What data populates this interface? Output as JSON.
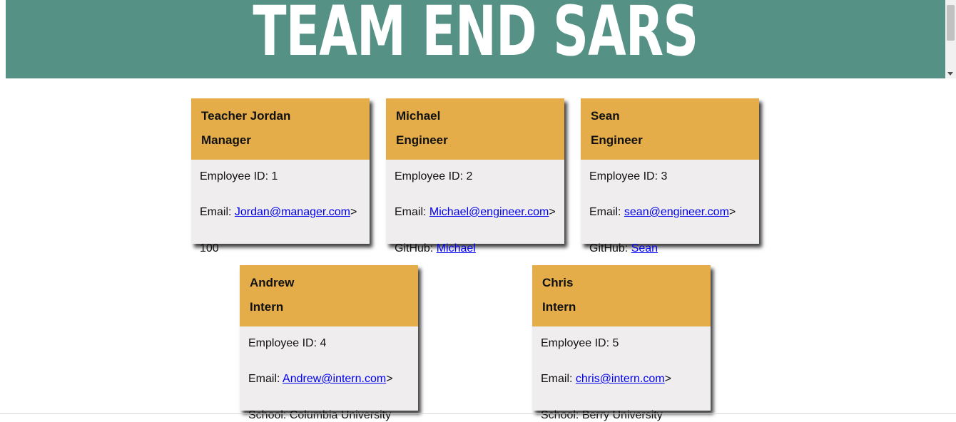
{
  "header": {
    "title": "TEAM END SARS"
  },
  "cards": [
    {
      "name": "Teacher Jordan",
      "role": "Manager",
      "id_text": "Employee ID: 1",
      "email_prefix": "Email: ",
      "email": "Jordan@manager.com",
      "email_suffix": ">",
      "extra_label": "",
      "extra_value": "100"
    },
    {
      "name": "Michael",
      "role": "Engineer",
      "id_text": "Employee ID: 2",
      "email_prefix": "Email: ",
      "email": "Michael@engineer.com",
      "email_suffix": ">",
      "extra_label": "GitHub: ",
      "extra_value": "Michael"
    },
    {
      "name": "Sean",
      "role": "Engineer",
      "id_text": "Employee ID: 3",
      "email_prefix": "Email: ",
      "email": "sean@engineer.com",
      "email_suffix": ">",
      "extra_label": "GitHub: ",
      "extra_value": "Sean"
    },
    {
      "name": "Andrew",
      "role": "Intern",
      "id_text": "Employee ID: 4",
      "email_prefix": "Email: ",
      "email": "Andrew@intern.com",
      "email_suffix": ">",
      "extra_label": "School: ",
      "extra_value": "Columbia University"
    },
    {
      "name": "Chris",
      "role": "Intern",
      "id_text": "Employee ID: 5",
      "email_prefix": "Email: ",
      "email": "chris@intern.com",
      "email_suffix": ">",
      "extra_label": "School: ",
      "extra_value": "Berry University"
    }
  ],
  "colors": {
    "banner": "#559285",
    "card_header": "#e4ad4a",
    "card_body": "#efedee",
    "link": "#0000ee"
  }
}
